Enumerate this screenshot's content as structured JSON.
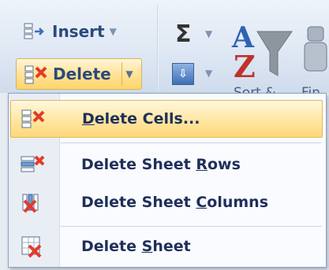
{
  "ribbon": {
    "insert_label": "Insert",
    "delete_label": "Delete",
    "sort_partial": "Sort &",
    "find_partial": "Fin"
  },
  "menu": {
    "items": [
      {
        "label": "Delete Cells...",
        "icon": "delete-cells-icon",
        "highlighted": true
      },
      {
        "label": "Delete Sheet Rows",
        "icon": "delete-rows-icon",
        "highlighted": false
      },
      {
        "label": "Delete Sheet Columns",
        "icon": "delete-columns-icon",
        "highlighted": false
      },
      {
        "label": "Delete Sheet",
        "icon": "delete-sheet-icon",
        "highlighted": false
      }
    ]
  },
  "colors": {
    "highlight": "#ffe6a1",
    "menu_text": "#1f2f5a",
    "delete_x": "#e23b2a"
  }
}
